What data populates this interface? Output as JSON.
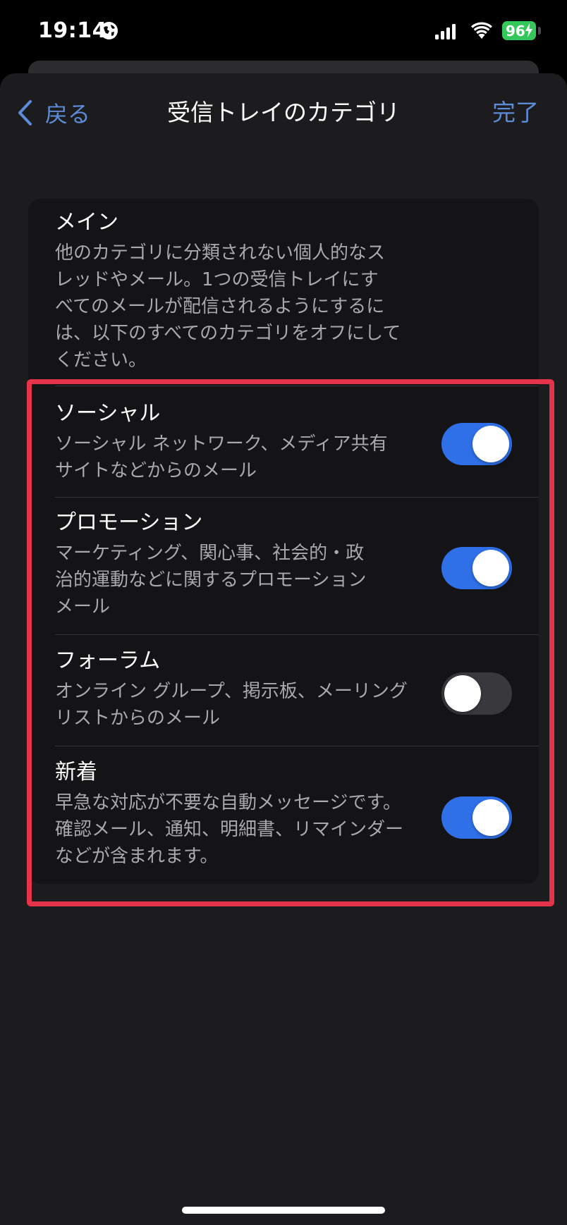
{
  "status_bar": {
    "time": "19:14",
    "battery": "96"
  },
  "nav": {
    "back_label": "戻る",
    "title": "受信トレイのカテゴリ",
    "done_label": "完了"
  },
  "categories": [
    {
      "title": "メイン",
      "description": [
        "他のカテゴリに分類されない個人的なス",
        "レッドやメール。1つの受信トレイにす",
        "べてのメールが配信されるようにするに",
        "は、以下のすべてのカテゴリをオフにして",
        "ください。"
      ]
    },
    {
      "title": "ソーシャル",
      "description": [
        "ソーシャル ネットワーク、メディア共有",
        "サイトなどからのメール"
      ],
      "enabled": true
    },
    {
      "title": "プロモーション",
      "description": [
        "マーケティング、関心事、社会的・政",
        "治的運動などに関するプロモーション",
        "メール"
      ],
      "enabled": true
    },
    {
      "title": "フォーラム",
      "description": [
        "オンライン グループ、掲示板、メーリング",
        "リストからのメール"
      ],
      "enabled": false
    },
    {
      "title": "新着",
      "description": [
        "早急な対応が不要な自動メッセージです。",
        "確認メール、通知、明細書、リマインダー",
        "などが含まれます。"
      ],
      "enabled": true
    }
  ],
  "colors": {
    "accent": "#5e8bd6",
    "toggle_on": "#2f6fe8",
    "highlight": "#e5334a",
    "battery": "#34c759"
  }
}
